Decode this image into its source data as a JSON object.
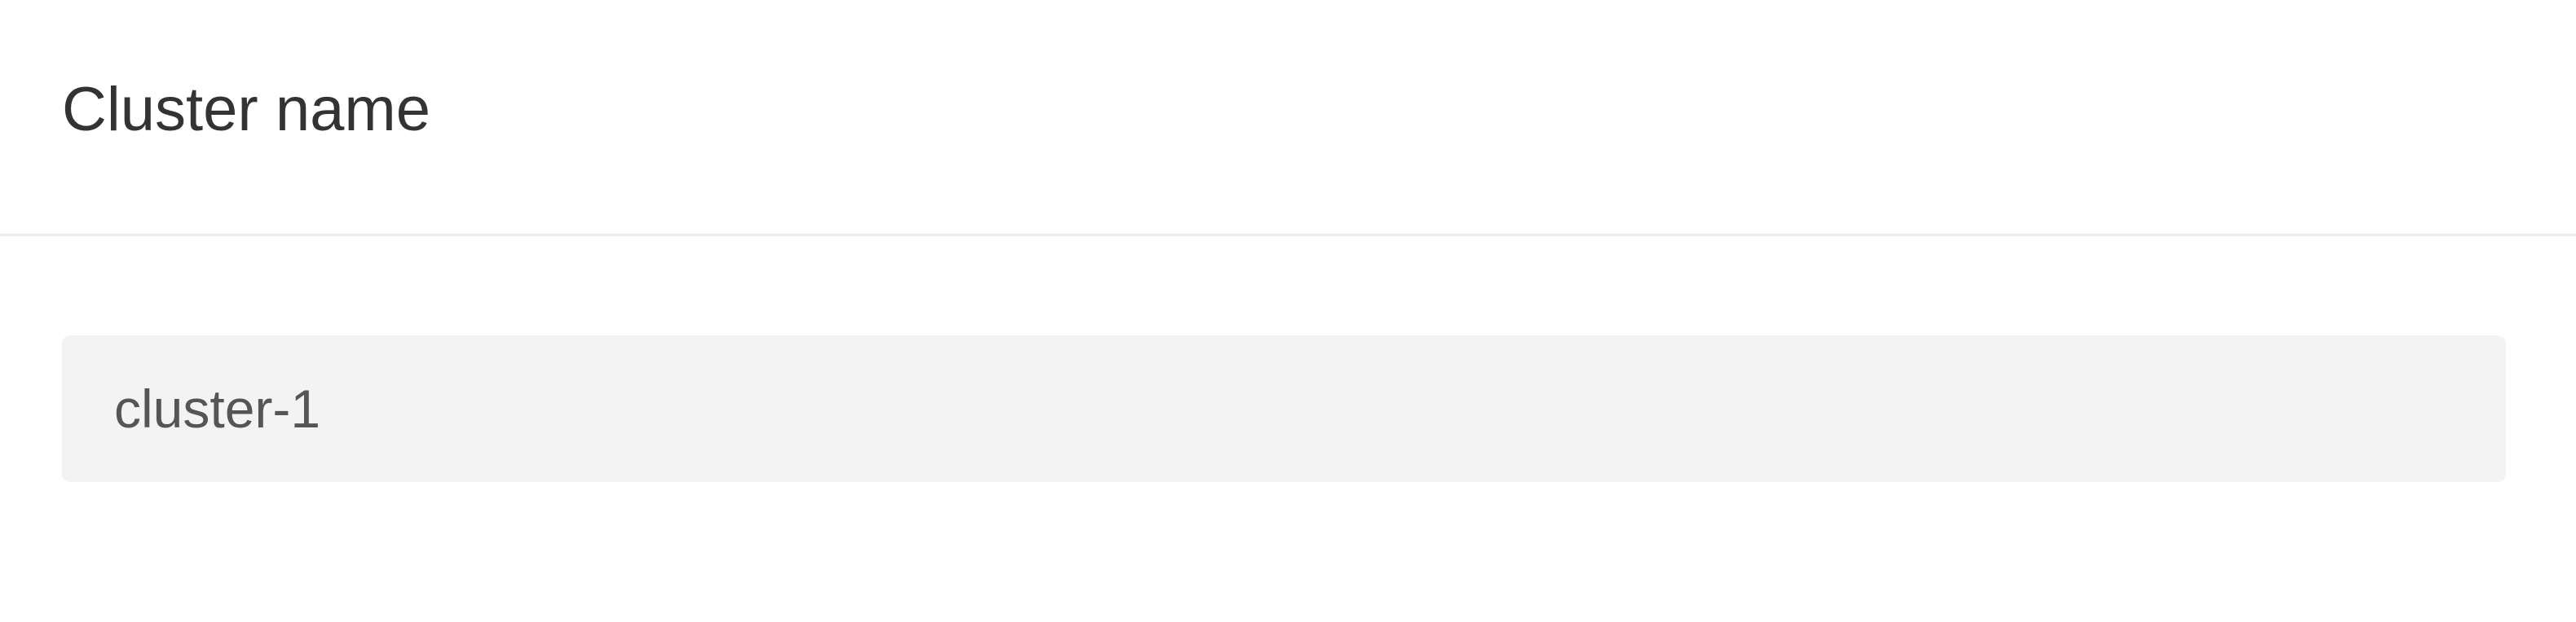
{
  "settings": {
    "cluster_name": {
      "label": "Cluster name",
      "value": "cluster-1"
    }
  }
}
